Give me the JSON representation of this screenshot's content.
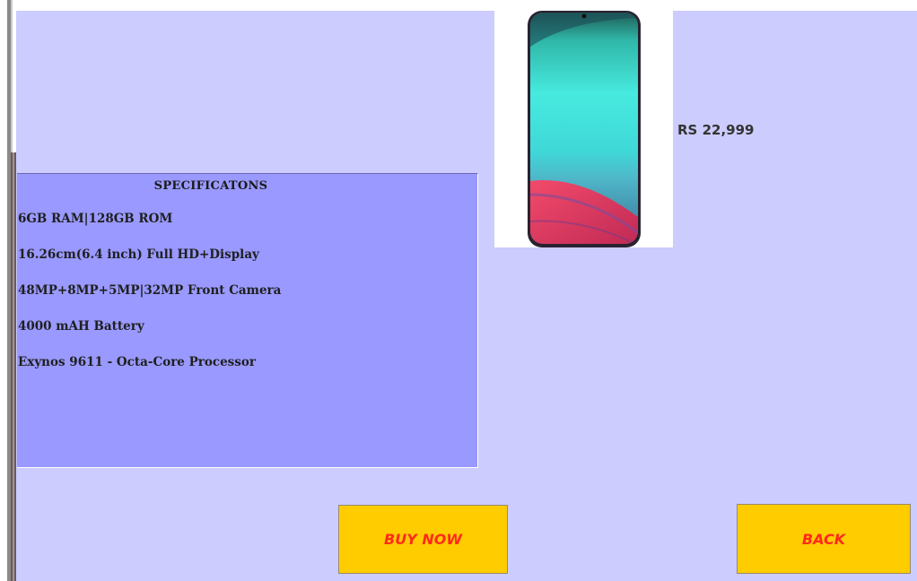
{
  "specifications": {
    "title": "SPECIFICATONS",
    "lines": [
      "6GB RAM|128GB ROM",
      "16.26cm(6.4 inch) Full HD+Display",
      "48MP+8MP+5MP|32MP Front Camera",
      "4000 mAH Battery",
      "Exynos 9611 - Octa-Core Processor"
    ]
  },
  "product": {
    "price": "RS 22,999",
    "image_icon": "smartphone-image"
  },
  "actions": {
    "buy_label": "BUY NOW",
    "back_label": "BACK"
  },
  "colors": {
    "panel_bg": "#ccccff",
    "specs_bg": "#9999ff",
    "button_bg": "#ffcc00",
    "button_text": "#ff2a1a"
  }
}
